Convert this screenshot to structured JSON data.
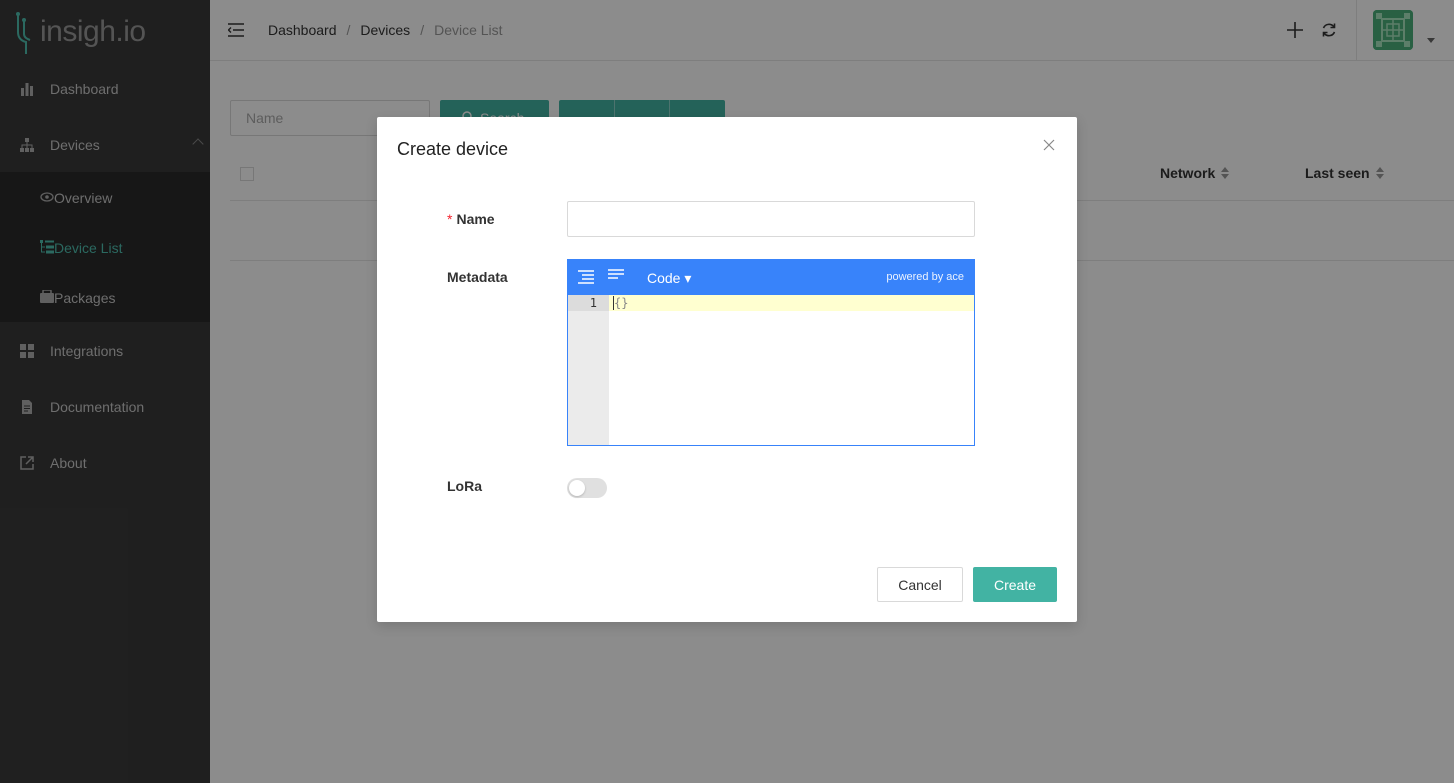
{
  "app": {
    "logo_text": "insigh.io"
  },
  "sidebar": {
    "items": [
      {
        "label": "Dashboard",
        "icon": "bar-chart-icon"
      },
      {
        "label": "Devices",
        "icon": "sitemap-icon"
      },
      {
        "label": "Integrations",
        "icon": "grid-icon"
      },
      {
        "label": "Documentation",
        "icon": "document-icon"
      },
      {
        "label": "About",
        "icon": "external-link-icon"
      }
    ],
    "submenu": [
      {
        "label": "Overview",
        "icon": "eye-icon"
      },
      {
        "label": "Device List",
        "icon": "list-tree-icon",
        "active": true
      },
      {
        "label": "Packages",
        "icon": "package-icon"
      }
    ],
    "active_color": "#4fbfb0"
  },
  "header": {
    "breadcrumb": [
      "Dashboard",
      "Devices",
      "Device List"
    ],
    "separator": "/"
  },
  "page": {
    "filter_placeholder": "Name",
    "search_label": "Search",
    "table_columns": [
      "Network",
      "Last seen"
    ]
  },
  "modal": {
    "title": "Create device",
    "name_label": "Name",
    "name_value": "",
    "metadata_label": "Metadata",
    "editor": {
      "mode_label": "Code ▾",
      "powered_by": "powered by ace",
      "line_number": "1",
      "content": "{}"
    },
    "lora_label": "LoRa",
    "lora_enabled": false,
    "cancel_label": "Cancel",
    "create_label": "Create"
  },
  "colors": {
    "accent": "#42b3a3",
    "editor_blue": "#3883fa",
    "sidebar_bg": "#3a3a3a"
  }
}
